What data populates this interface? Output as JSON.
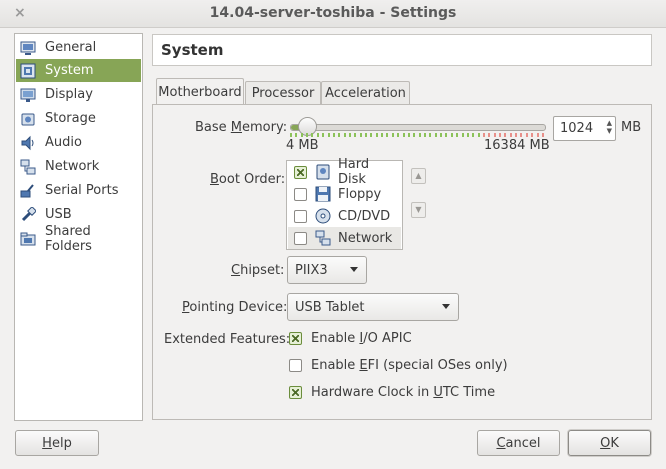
{
  "window": {
    "title": "14.04-server-toshiba - Settings",
    "close_glyph": "×"
  },
  "sidebar": {
    "items": [
      {
        "label": "General",
        "icon": "general-icon",
        "selected": false
      },
      {
        "label": "System",
        "icon": "system-icon",
        "selected": true
      },
      {
        "label": "Display",
        "icon": "display-icon",
        "selected": false
      },
      {
        "label": "Storage",
        "icon": "storage-icon",
        "selected": false
      },
      {
        "label": "Audio",
        "icon": "audio-icon",
        "selected": false
      },
      {
        "label": "Network",
        "icon": "network-icon",
        "selected": false
      },
      {
        "label": "Serial Ports",
        "icon": "serial-ports-icon",
        "selected": false
      },
      {
        "label": "USB",
        "icon": "usb-icon",
        "selected": false
      },
      {
        "label": "Shared Folders",
        "icon": "shared-folders-icon",
        "selected": false
      }
    ]
  },
  "header": {
    "title": "System"
  },
  "tabs": [
    {
      "label": "Motherboard",
      "active": true
    },
    {
      "label": "Processor",
      "active": false
    },
    {
      "label": "Acceleration",
      "active": false
    }
  ],
  "motherboard": {
    "base_memory": {
      "label_pre": "Base ",
      "label_u": "M",
      "label_post": "emory:",
      "value": "1024",
      "unit": "MB",
      "min_label": "4 MB",
      "max_label": "16384 MB",
      "fraction": 0.062
    },
    "boot_order": {
      "label_pre": "",
      "label_u": "B",
      "label_post": "oot Order:",
      "items": [
        {
          "label": "Hard Disk",
          "checked": true,
          "icon": "hard-disk-icon"
        },
        {
          "label": "Floppy",
          "checked": false,
          "icon": "floppy-icon"
        },
        {
          "label": "CD/DVD",
          "checked": false,
          "icon": "cd-dvd-icon"
        },
        {
          "label": "Network",
          "checked": false,
          "icon": "network-icon"
        }
      ]
    },
    "chipset": {
      "label_pre": "",
      "label_u": "C",
      "label_post": "hipset:",
      "value": "PIIX3"
    },
    "pointing_device": {
      "label_pre": "",
      "label_u": "P",
      "label_post": "ointing Device:",
      "value": "USB Tablet"
    },
    "extended_features": {
      "label": "Extended Features:",
      "options": [
        {
          "pre": "Enable ",
          "u": "I",
          "post": "/O APIC",
          "checked": true
        },
        {
          "pre": "Enable ",
          "u": "E",
          "post": "FI (special OSes only)",
          "checked": false
        },
        {
          "pre": "Hardware Clock in ",
          "u": "U",
          "post": "TC Time",
          "checked": true
        }
      ]
    }
  },
  "buttons": {
    "help_u": "H",
    "help_rest": "elp",
    "cancel_u": "C",
    "cancel_rest": "ancel",
    "ok_u": "O",
    "ok_rest": "K"
  },
  "colors": {
    "accent": "#87a556",
    "tick_green": "#8cc25a",
    "tick_red": "#e8908a"
  }
}
